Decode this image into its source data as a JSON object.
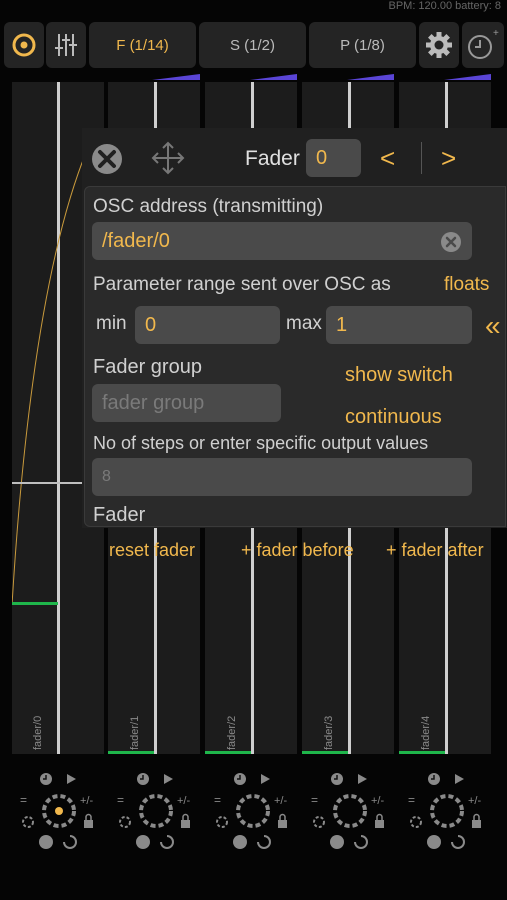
{
  "status_bar": {
    "text": "BPM: 120.00 battery: 8"
  },
  "topbar": {
    "tabs": [
      {
        "label": "F (1/14)"
      },
      {
        "label": "S (1/2)"
      },
      {
        "label": "P (1/8)"
      }
    ]
  },
  "faders": [
    {
      "label": "fader/0"
    },
    {
      "label": "fader/1"
    },
    {
      "label": "fader/2"
    },
    {
      "label": "fader/3"
    },
    {
      "label": "fader/4"
    }
  ],
  "editor": {
    "title": "Fader",
    "index_value": "0",
    "prev_label": "<",
    "next_label": ">",
    "osc_address_label": "OSC address (transmitting)",
    "osc_address_value": "/fader/0",
    "range_label": "Parameter range sent over OSC as",
    "range_type": "floats",
    "min_label": "min",
    "min_value": "0",
    "max_label": "max",
    "max_value": "1",
    "collapse_label": "«",
    "fader_group_label": "Fader group",
    "fader_group_placeholder": "fader group",
    "show_switch_label": "show switch",
    "continuous_label": "continuous",
    "steps_label": "No of steps or enter specific output values",
    "steps_placeholder": "8",
    "type_label": "Fader"
  },
  "actions": {
    "reset": "reset fader",
    "before": "+ fader before",
    "after": "+ fader after"
  },
  "colors": {
    "accent": "#f1b84d",
    "green": "#1fb64b",
    "panel": "#2a2a2a"
  }
}
